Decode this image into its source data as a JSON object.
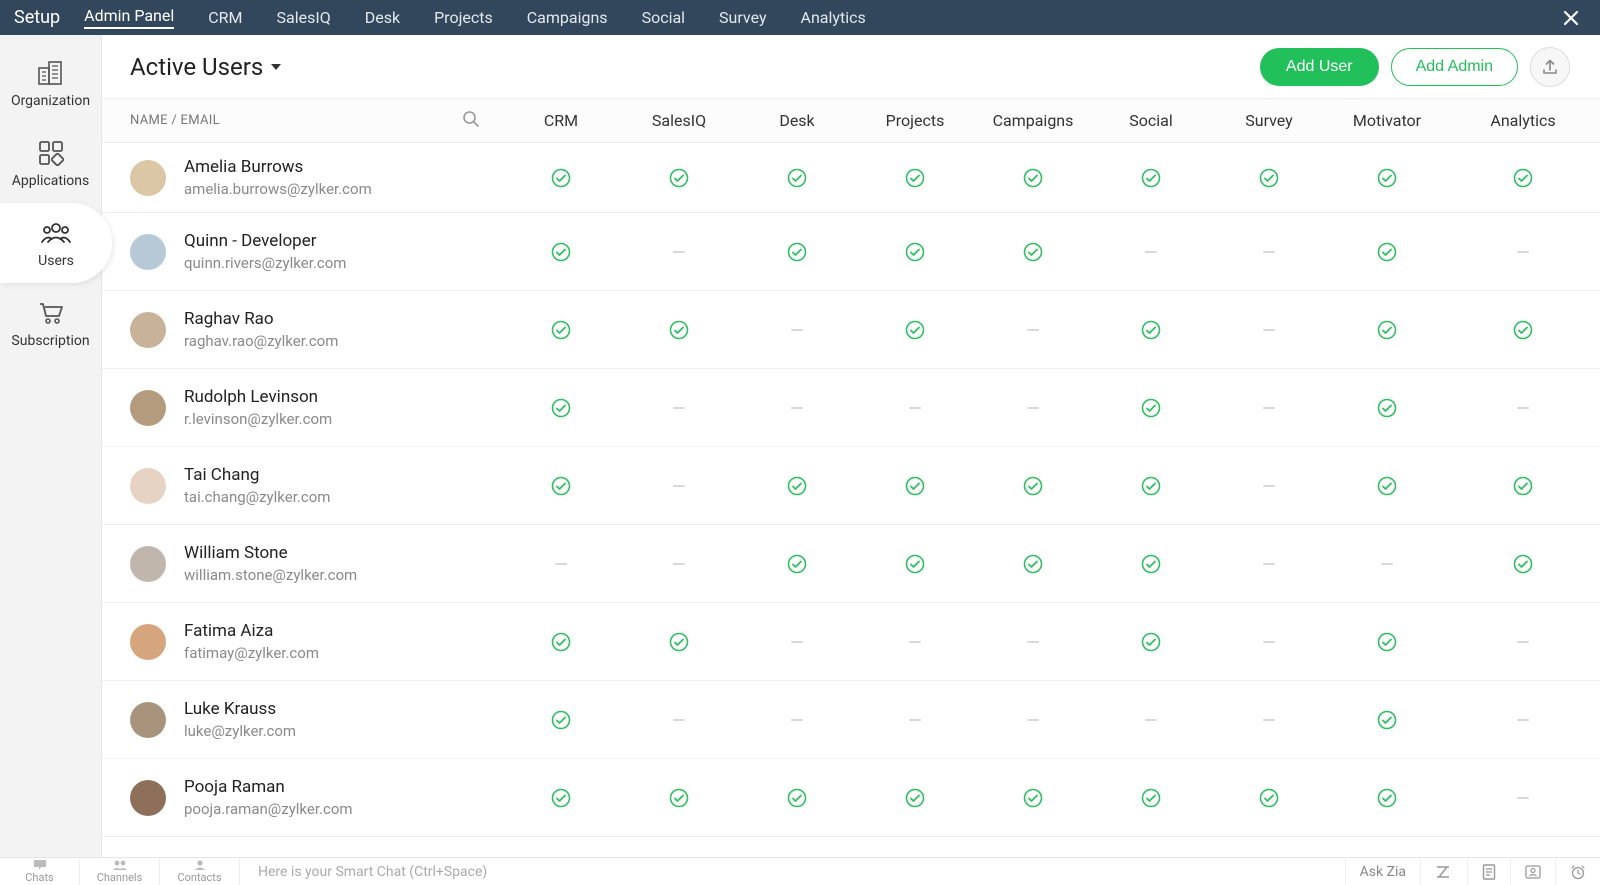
{
  "topnav": {
    "brand": "Setup",
    "tabs": [
      "Admin Panel",
      "CRM",
      "SalesIQ",
      "Desk",
      "Projects",
      "Campaigns",
      "Social",
      "Survey",
      "Analytics"
    ],
    "activeTab": 0
  },
  "sidebar": {
    "items": [
      {
        "label": "Organization",
        "icon": "building-icon"
      },
      {
        "label": "Applications",
        "icon": "apps-icon"
      },
      {
        "label": "Users",
        "icon": "users-icon"
      },
      {
        "label": "Subscription",
        "icon": "cart-icon"
      }
    ],
    "activeIndex": 2
  },
  "page": {
    "title": "Active Users",
    "addUserLabel": "Add User",
    "addAdminLabel": "Add Admin"
  },
  "table": {
    "nameHeader": "NAME / EMAIL",
    "columns": [
      "CRM",
      "SalesIQ",
      "Desk",
      "Projects",
      "Campaigns",
      "Social",
      "Survey",
      "Motivator",
      "Analytics"
    ]
  },
  "users": [
    {
      "name": "Amelia Burrows",
      "email": "amelia.burrows@zylker.com",
      "avatar": "#d9c7a6",
      "access": [
        true,
        true,
        true,
        true,
        true,
        true,
        true,
        true,
        true
      ]
    },
    {
      "name": "Quinn - Developer",
      "email": "quinn.rivers@zylker.com",
      "avatar": "#b7c8d6",
      "access": [
        true,
        false,
        true,
        true,
        true,
        false,
        false,
        true,
        false
      ]
    },
    {
      "name": "Raghav Rao",
      "email": "raghav.rao@zylker.com",
      "avatar": "#c8b29a",
      "access": [
        true,
        true,
        false,
        true,
        false,
        true,
        false,
        true,
        true
      ]
    },
    {
      "name": "Rudolph Levinson",
      "email": "r.levinson@zylker.com",
      "avatar": "#b59b7d",
      "access": [
        true,
        false,
        false,
        false,
        false,
        true,
        false,
        true,
        false
      ]
    },
    {
      "name": "Tai Chang",
      "email": "tai.chang@zylker.com",
      "avatar": "#e6d3c4",
      "access": [
        true,
        false,
        true,
        true,
        true,
        true,
        false,
        true,
        true
      ]
    },
    {
      "name": "William Stone",
      "email": "william.stone@zylker.com",
      "avatar": "#c1b6ac",
      "access": [
        false,
        false,
        true,
        true,
        true,
        true,
        false,
        false,
        true
      ]
    },
    {
      "name": "Fatima Aiza",
      "email": "fatimay@zylker.com",
      "avatar": "#d5a67e",
      "access": [
        true,
        true,
        false,
        false,
        false,
        true,
        false,
        true,
        false
      ]
    },
    {
      "name": "Luke Krauss",
      "email": "luke@zylker.com",
      "avatar": "#a8937d",
      "access": [
        true,
        false,
        false,
        false,
        false,
        false,
        false,
        true,
        false
      ]
    },
    {
      "name": "Pooja Raman",
      "email": "pooja.raman@zylker.com",
      "avatar": "#8d6f5a",
      "access": [
        true,
        true,
        true,
        true,
        true,
        true,
        true,
        true,
        false
      ]
    }
  ],
  "footer": {
    "tabs": [
      "Chats",
      "Channels",
      "Contacts"
    ],
    "smartChatPlaceholder": "Here is your Smart Chat (Ctrl+Space)",
    "askZia": "Ask Zia"
  }
}
